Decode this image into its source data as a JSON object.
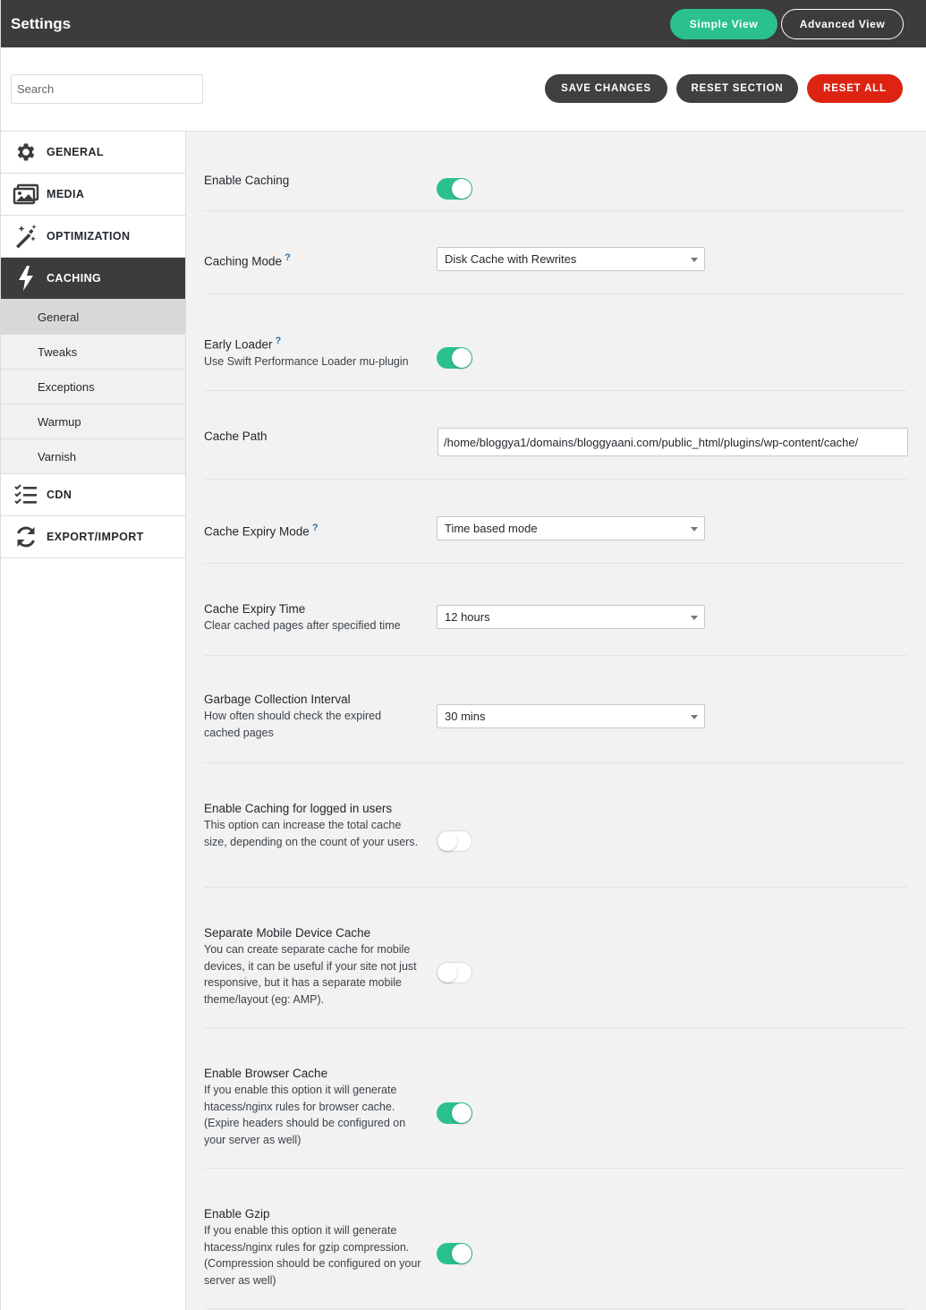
{
  "header": {
    "title": "Settings",
    "simple_view": "Simple View",
    "advanced_view": "Advanced View"
  },
  "toolbar": {
    "search_placeholder": "Search",
    "save": "SAVE CHANGES",
    "reset_section": "RESET SECTION",
    "reset_all": "RESET ALL"
  },
  "sidebar": {
    "items": [
      {
        "label": "GENERAL",
        "icon": "gear-icon"
      },
      {
        "label": "MEDIA",
        "icon": "images-icon"
      },
      {
        "label": "OPTIMIZATION",
        "icon": "magic-wand-icon"
      },
      {
        "label": "CACHING",
        "icon": "lightning-bolt-icon"
      },
      {
        "label": "CDN",
        "icon": "checklist-icon"
      },
      {
        "label": "EXPORT/IMPORT",
        "icon": "sync-icon"
      }
    ],
    "caching_sub": [
      "General",
      "Tweaks",
      "Exceptions",
      "Warmup",
      "Varnish"
    ]
  },
  "settings": {
    "enable_caching": {
      "label": "Enable Caching",
      "on": true
    },
    "caching_mode": {
      "label": "Caching Mode",
      "help": "?",
      "value": "Disk Cache with Rewrites"
    },
    "early_loader": {
      "label": "Early Loader",
      "help": "?",
      "desc": "Use Swift Performance Loader mu-plugin",
      "on": true
    },
    "cache_path": {
      "label": "Cache Path",
      "value": "/home/bloggya1/domains/bloggyaani.com/public_html/plugins/wp-content/cache/"
    },
    "cache_expiry_mode": {
      "label": "Cache Expiry Mode",
      "help": "?",
      "value": "Time based mode"
    },
    "cache_expiry_time": {
      "label": "Cache Expiry Time",
      "desc": "Clear cached pages after specified time",
      "value": "12 hours"
    },
    "gc_interval": {
      "label": "Garbage Collection Interval",
      "desc": "How often should check the expired cached pages",
      "value": "30 mins"
    },
    "logged_in": {
      "label": "Enable Caching for logged in users",
      "desc": "This option can increase the total cache size, depending on the count of your users.",
      "on": false
    },
    "mobile_cache": {
      "label": "Separate Mobile Device Cache",
      "desc": "You can create separate cache for mobile devices, it can be useful if your site not just responsive, but it has a separate mobile theme/layout (eg: AMP).",
      "on": false
    },
    "browser_cache": {
      "label": "Enable Browser Cache",
      "desc": "If you enable this option it will generate htacess/nginx rules for browser cache. (Expire headers should be configured on your server as well)",
      "on": true
    },
    "gzip": {
      "label": "Enable Gzip",
      "desc": "If you enable this option it will generate htacess/nginx rules for gzip compression. (Compression should be configured on your server as well)",
      "on": true
    }
  },
  "colors": {
    "header_bg": "#3c3c3c",
    "accent_green": "#2ac18e",
    "danger_red": "#dd2413",
    "button_dark": "#404040"
  }
}
